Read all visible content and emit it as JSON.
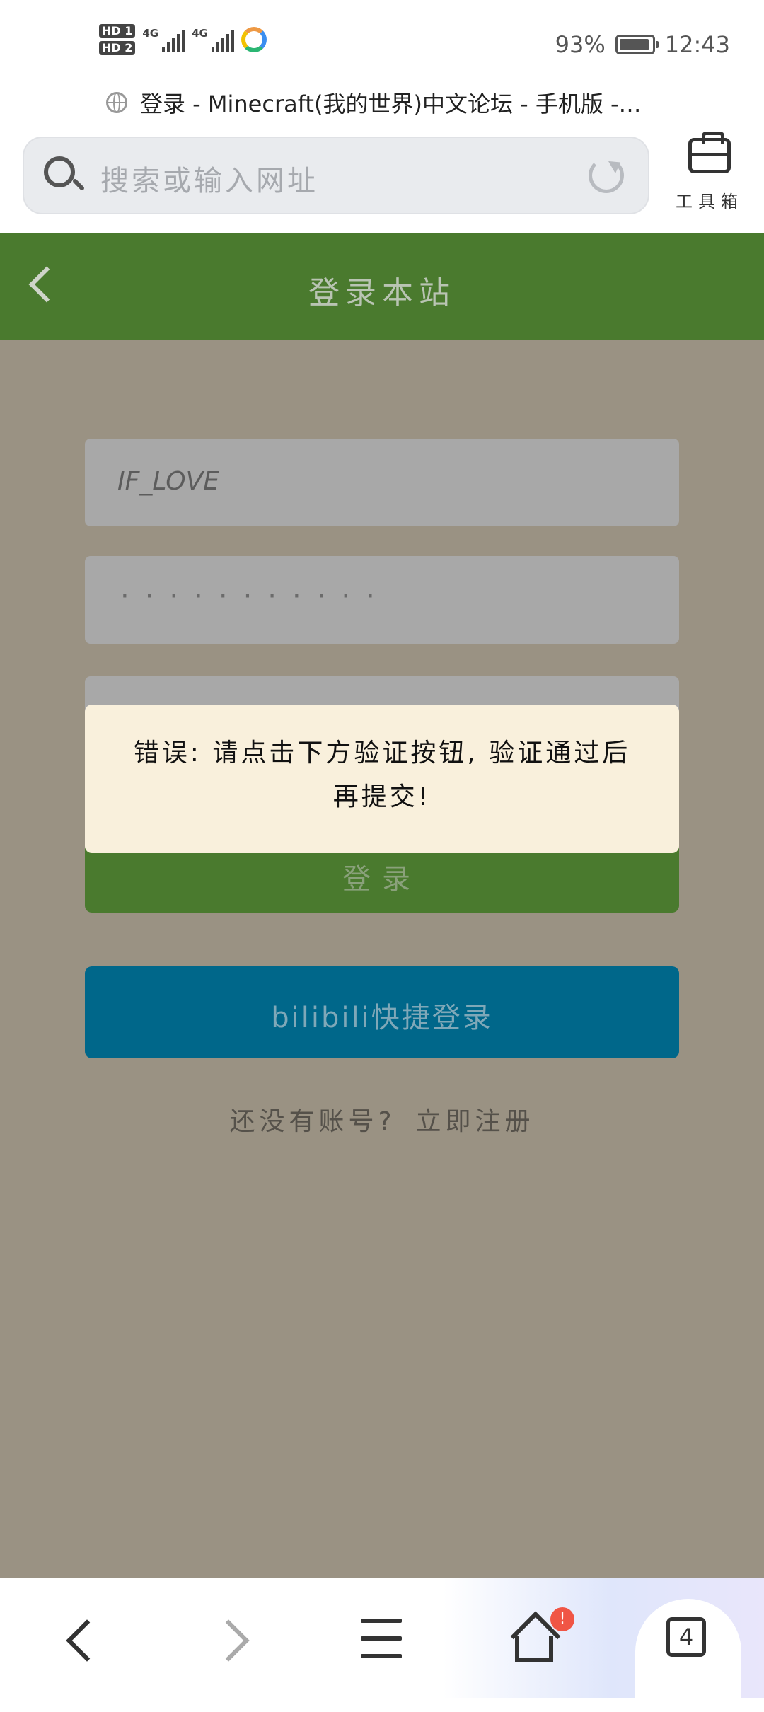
{
  "status_bar": {
    "hd1": "HD 1",
    "hd2": "HD 2",
    "sig1_label": "4G",
    "sig2_label": "4G",
    "battery": "93%",
    "battery_level": 0.93,
    "time": "12:43"
  },
  "browser": {
    "page_title": "登录 - Minecraft(我的世界)中文论坛 - 手机版 -…",
    "search_placeholder": "搜索或输入网址",
    "toolbox_label": "工具箱"
  },
  "app_header": {
    "title": "登录本站"
  },
  "form": {
    "username_value": "IF_LOVE",
    "password_mask": "···········",
    "login_button": "登录",
    "bilibili_button": "bilibili快捷登录",
    "no_account_text": "还没有账号?",
    "register_link": "立即注册"
  },
  "toast": {
    "message": "错误: 请点击下方验证按钮, 验证通过后再提交!"
  },
  "bottom_nav": {
    "home_badge": "!",
    "tab_count": "4"
  },
  "colors": {
    "header_green": "#4a7a2e",
    "bilibili_blue": "#00678a",
    "overlay": "#9a9283",
    "toast_bg": "#f9f0dc",
    "badge_red": "#f05545"
  }
}
